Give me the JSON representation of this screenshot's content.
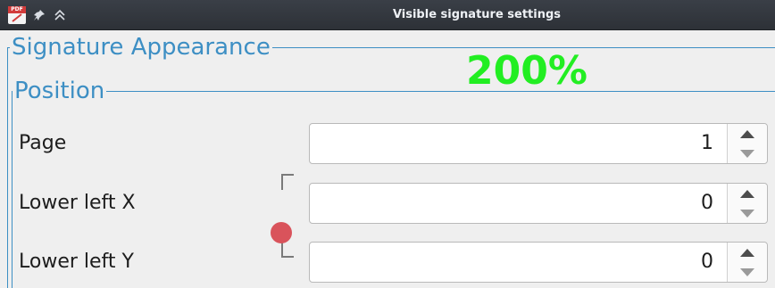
{
  "window": {
    "title": "Visible signature settings",
    "app_icon_text": "PDF"
  },
  "zoom": {
    "value_text": "200%",
    "color": "#22ee22"
  },
  "groups": {
    "appearance": {
      "title": "Signature Appearance"
    },
    "position": {
      "title": "Position"
    }
  },
  "fields": [
    {
      "label": "Page",
      "value": "1"
    },
    {
      "label": "Lower left X",
      "value": "0"
    },
    {
      "label": "Lower left Y",
      "value": "0"
    }
  ],
  "colors": {
    "accent": "#3d8fc4",
    "link_dot": "#d9535b",
    "titlebar": "#2d3137"
  },
  "icons": {
    "pin": "pin-icon",
    "collapse": "chevron-double-up-icon",
    "link": "link-toggle-icon"
  }
}
